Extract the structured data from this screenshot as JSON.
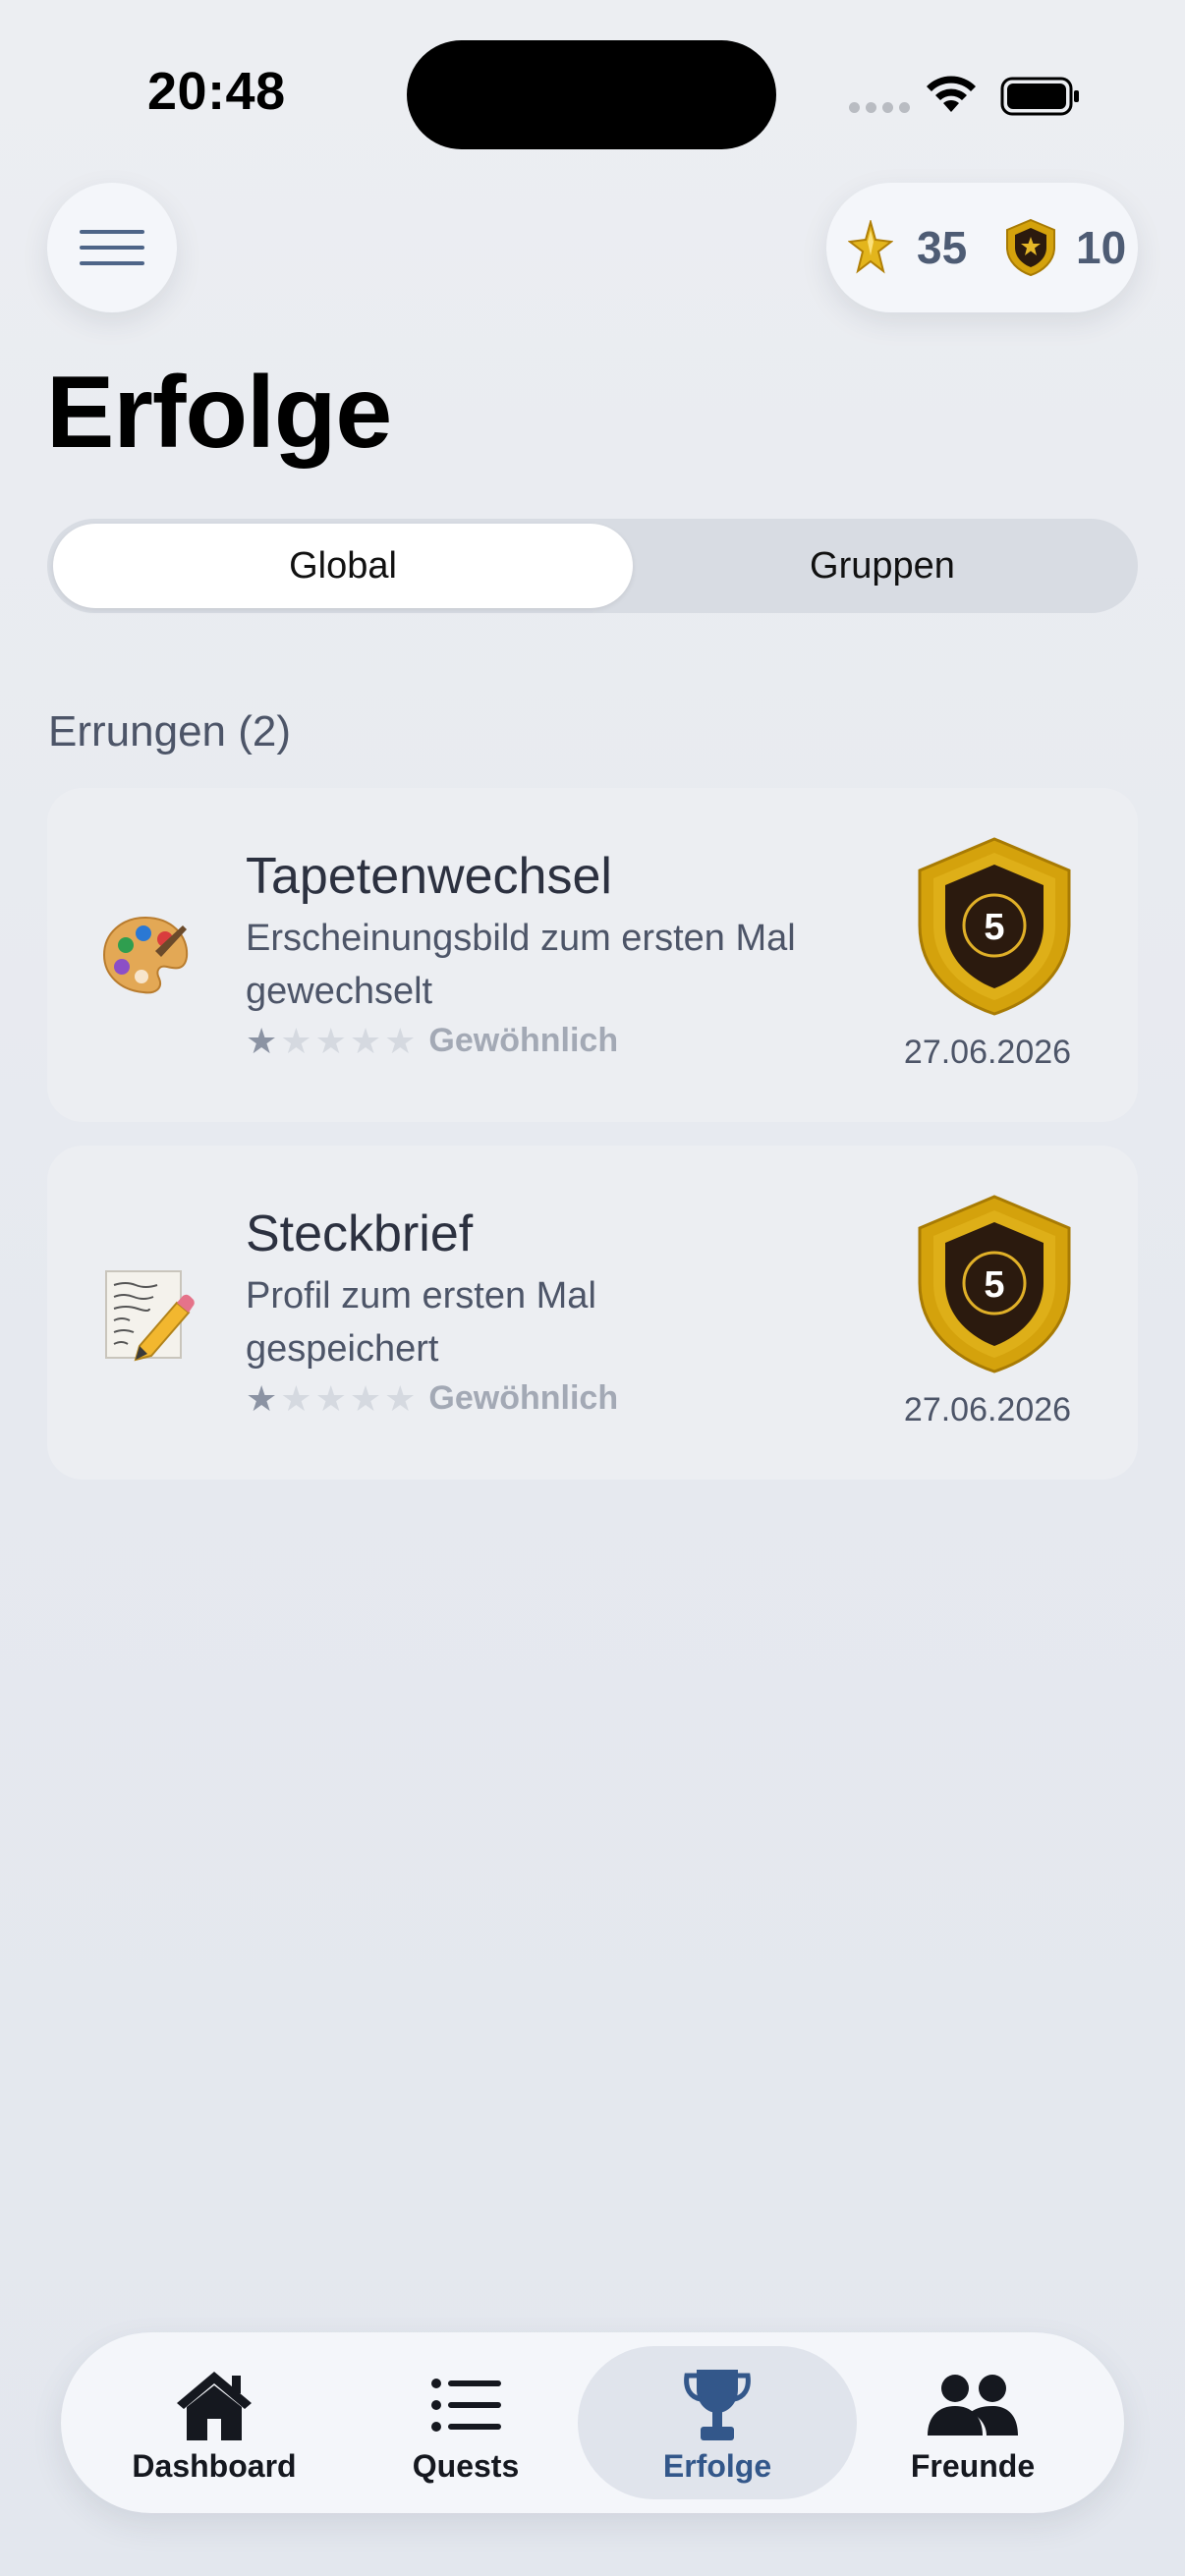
{
  "status_bar": {
    "time": "20:48"
  },
  "header": {
    "xp_count": "35",
    "badge_count": "10",
    "title": "Erfolge"
  },
  "segments": {
    "global_label": "Global",
    "groups_label": "Gruppen",
    "selected": "Global"
  },
  "section": {
    "label": "Errungen (2)"
  },
  "achievements": [
    {
      "icon": "palette-icon",
      "title": "Tapetenwechsel",
      "description": "Erscheinungsbild zum ersten Mal gewechselt",
      "rarity_label": "Gewöhnlich",
      "rarity_stars": 1,
      "rarity_max": 5,
      "badge_level": "5",
      "date": "27.06.2026"
    },
    {
      "icon": "memo-icon",
      "title": "Steckbrief",
      "description": "Profil zum ersten Mal gespeichert",
      "rarity_label": "Gewöhnlich",
      "rarity_stars": 1,
      "rarity_max": 5,
      "badge_level": "5",
      "date": "27.06.2026"
    }
  ],
  "tabbar": {
    "items": [
      {
        "label": "Dashboard",
        "icon": "home-icon"
      },
      {
        "label": "Quests",
        "icon": "list-icon"
      },
      {
        "label": "Erfolge",
        "icon": "trophy-icon"
      },
      {
        "label": "Freunde",
        "icon": "people-icon"
      }
    ],
    "active": "Erfolge"
  },
  "colors": {
    "accent": "#33578a",
    "badge_gold": "#d4a20c",
    "badge_dark": "#2b1a0e"
  }
}
